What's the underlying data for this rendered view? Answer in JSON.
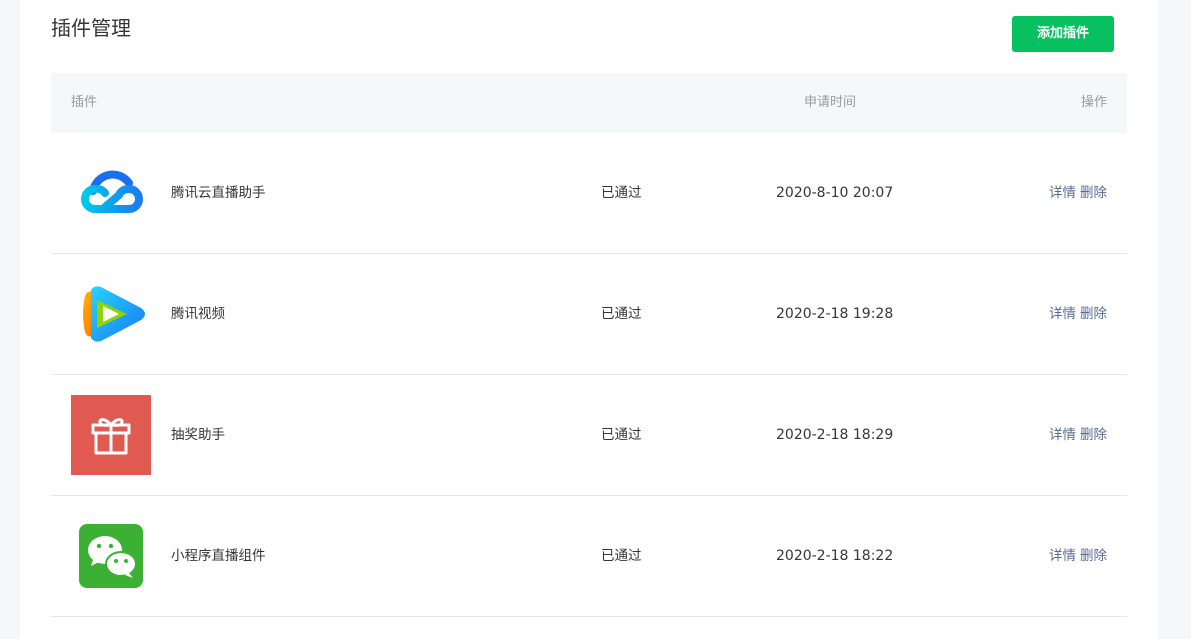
{
  "page": {
    "title": "插件管理",
    "add_button": "添加插件"
  },
  "table": {
    "headers": {
      "plugin": "插件",
      "time": "申请时间",
      "action": "操作"
    },
    "rows": [
      {
        "icon": "tencent-cloud-logo-icon",
        "name": "腾讯云直播助手",
        "status": "已通过",
        "time": "2020-8-10 20:07",
        "detail": "详情",
        "delete": "删除"
      },
      {
        "icon": "tencent-video-logo-icon",
        "name": "腾讯视频",
        "status": "已通过",
        "time": "2020-2-18 19:28",
        "detail": "详情",
        "delete": "删除"
      },
      {
        "icon": "gift-icon",
        "name": "抽奖助手",
        "status": "已通过",
        "time": "2020-2-18 18:29",
        "detail": "详情",
        "delete": "删除"
      },
      {
        "icon": "wechat-logo-icon",
        "name": "小程序直播组件",
        "status": "已通过",
        "time": "2020-2-18 18:22",
        "detail": "详情",
        "delete": "删除"
      }
    ]
  },
  "colors": {
    "primary": "#07c160",
    "link": "#576b95",
    "header_bg": "#f6f7f9",
    "gift_bg": "#e05a51",
    "wechat_green": "#3cb034"
  }
}
